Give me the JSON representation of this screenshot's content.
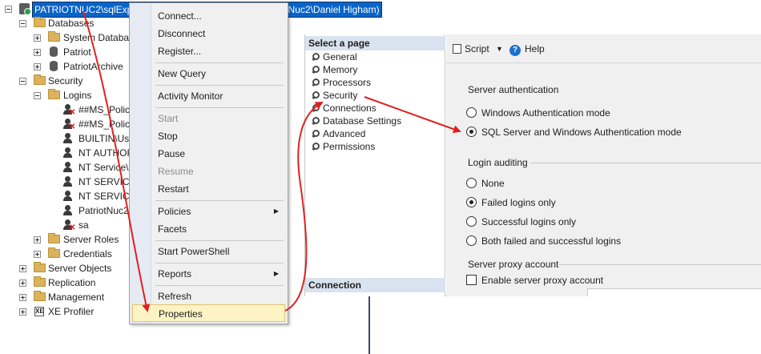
{
  "object_explorer": {
    "server": "PATRIOTNUC2\\sqlExpress (SQL Server 15.0.2000 - PatriotNuc2\\Daniel Higham)",
    "databases": "Databases",
    "system_databases": "System Databas",
    "db_patriot": "Patriot",
    "db_patriot_archive": "PatriotArchive",
    "security": "Security",
    "logins": "Logins",
    "login_1": "##MS_Policy",
    "login_2": "##MS_Policy",
    "login_3": "BUILTIN\\Use",
    "login_4": "NT AUTHOR",
    "login_5": "NT Service\\",
    "login_6": "NT SERVICE",
    "login_7": "NT SERVICE",
    "login_8": "PatriotNuc2",
    "login_9": "sa",
    "server_roles": "Server Roles",
    "credentials": "Credentials",
    "server_objects": "Server Objects",
    "replication": "Replication",
    "management": "Management",
    "xe_profiler": "XE Profiler"
  },
  "context_menu": {
    "connect": "Connect...",
    "disconnect": "Disconnect",
    "register": "Register...",
    "new_query": "New Query",
    "activity_monitor": "Activity Monitor",
    "start": "Start",
    "stop": "Stop",
    "pause": "Pause",
    "resume": "Resume",
    "restart": "Restart",
    "policies": "Policies",
    "facets": "Facets",
    "start_powershell": "Start PowerShell",
    "reports": "Reports",
    "refresh": "Refresh",
    "properties": "Properties"
  },
  "properties_dialog": {
    "select_page_header": "Select a page",
    "pages": {
      "general": "General",
      "memory": "Memory",
      "processors": "Processors",
      "security": "Security",
      "connections": "Connections",
      "database_settings": "Database Settings",
      "advanced": "Advanced",
      "permissions": "Permissions"
    },
    "connection_header": "Connection",
    "toolbar": {
      "script": "Script",
      "help": "Help"
    },
    "server_authentication": {
      "label": "Server authentication",
      "windows_mode": "Windows Authentication mode",
      "mixed_mode": "SQL Server and Windows Authentication mode",
      "selected": "SQL Server and Windows Authentication mode"
    },
    "login_auditing": {
      "label": "Login auditing",
      "none": "None",
      "failed_only": "Failed logins only",
      "successful_only": "Successful logins only",
      "both": "Both failed and successful logins",
      "selected": "Failed logins only"
    },
    "server_proxy": {
      "label": "Server proxy account",
      "enable": "Enable server proxy account",
      "enabled": false
    }
  },
  "colors": {
    "selection": "#0a64c8",
    "menu_highlight": "#fdf3c4",
    "annotation_arrow": "#e02020",
    "pane_header": "#d9e3ef"
  }
}
